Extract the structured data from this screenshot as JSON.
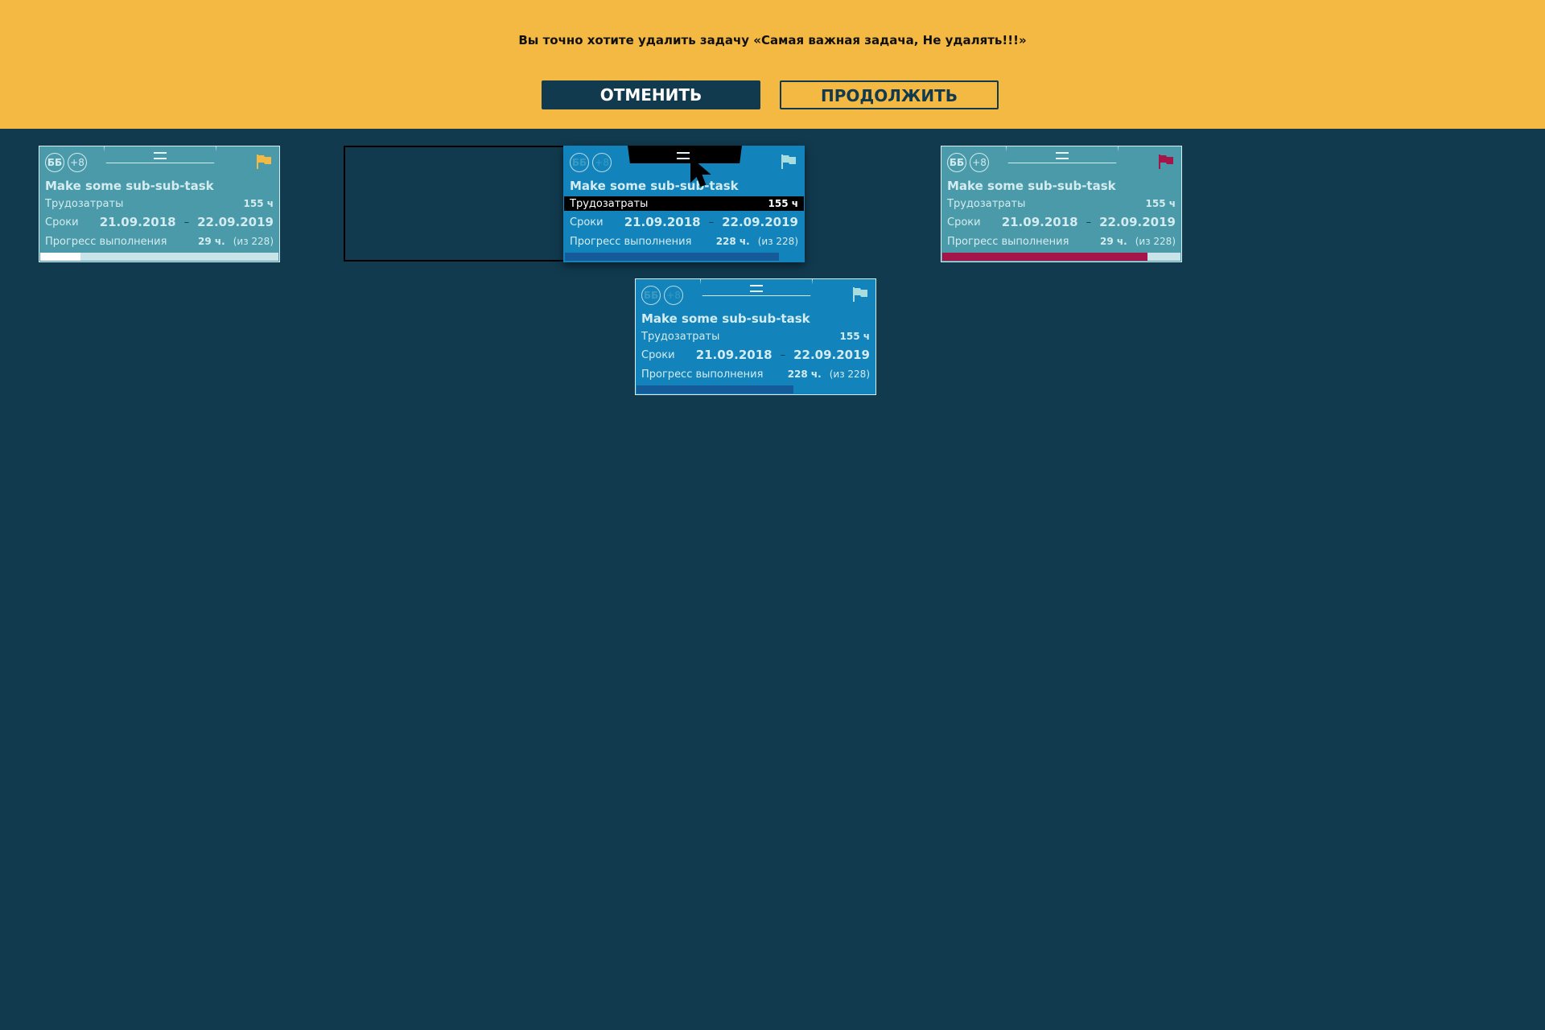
{
  "dialog": {
    "message": "Вы точно хотите удалить задачу «Самая важная задача, Не удалять!!!»",
    "cancel_label": "ОТМЕНИТЬ",
    "continue_label": "ПРОДОЛЖИТЬ"
  },
  "colors": {
    "background": "#113a4f",
    "banner": "#f4b942",
    "card_teal": "#4a9aaa",
    "card_blue": "#1283bb",
    "flag_yellow": "#f4b942",
    "flag_red": "#a6154a",
    "progress_red": "#a6154a",
    "progress_blue": "#155b9a"
  },
  "cards": [
    {
      "avatar": "ББ",
      "more": "+8",
      "title": "Make some sub-sub-task",
      "effort_label": "Трудозатраты",
      "effort": "155 ч",
      "dates_label": "Сроки",
      "start": "21.09.2018",
      "end": "22.09.2019",
      "progress_label": "Прогресс выполнения",
      "progress": "29 ч.",
      "total": "(из 228)",
      "flag_icon": "flag-icon",
      "flag_color": "#f4b942",
      "progress_fill": 0.17,
      "fill_color": "#ffffff"
    },
    {
      "avatar": "ББ",
      "more": "+8",
      "title": "Make some sub-sub-task",
      "effort_label": "Трудозатраты",
      "effort": "155 ч",
      "dates_label": "Сроки",
      "start": "21.09.2018",
      "end": "22.09.2019",
      "progress_label": "Прогресс выполнения",
      "progress": "228 ч.",
      "total": "(из 228)",
      "flag_icon": "flag-icon",
      "flag_color": "#a8dde0",
      "progress_fill": 0.9,
      "fill_color": "#155b9a"
    },
    {
      "avatar": "ББ",
      "more": "+8",
      "title": "Make some sub-sub-task",
      "effort_label": "Трудозатраты",
      "effort": "155 ч",
      "dates_label": "Сроки",
      "start": "21.09.2018",
      "end": "22.09.2019",
      "progress_label": "Прогресс выполнения",
      "progress": "29 ч.",
      "total": "(из 228)",
      "flag_icon": "flag-icon",
      "flag_color": "#a6154a",
      "progress_fill": 0.86,
      "fill_color": "#a6154a"
    },
    {
      "avatar": "ББ",
      "more": "+8",
      "title": "Make some sub-sub-task",
      "effort_label": "Трудозатраты",
      "effort": "155 ч",
      "dates_label": "Сроки",
      "start": "21.09.2018",
      "end": "22.09.2019",
      "progress_label": "Прогресс выполнения",
      "progress": "228 ч.",
      "total": "(из 228)",
      "flag_icon": "flag-icon",
      "flag_color": "#a8dde0",
      "progress_fill": 0.66,
      "fill_color": "#155b9a"
    }
  ]
}
